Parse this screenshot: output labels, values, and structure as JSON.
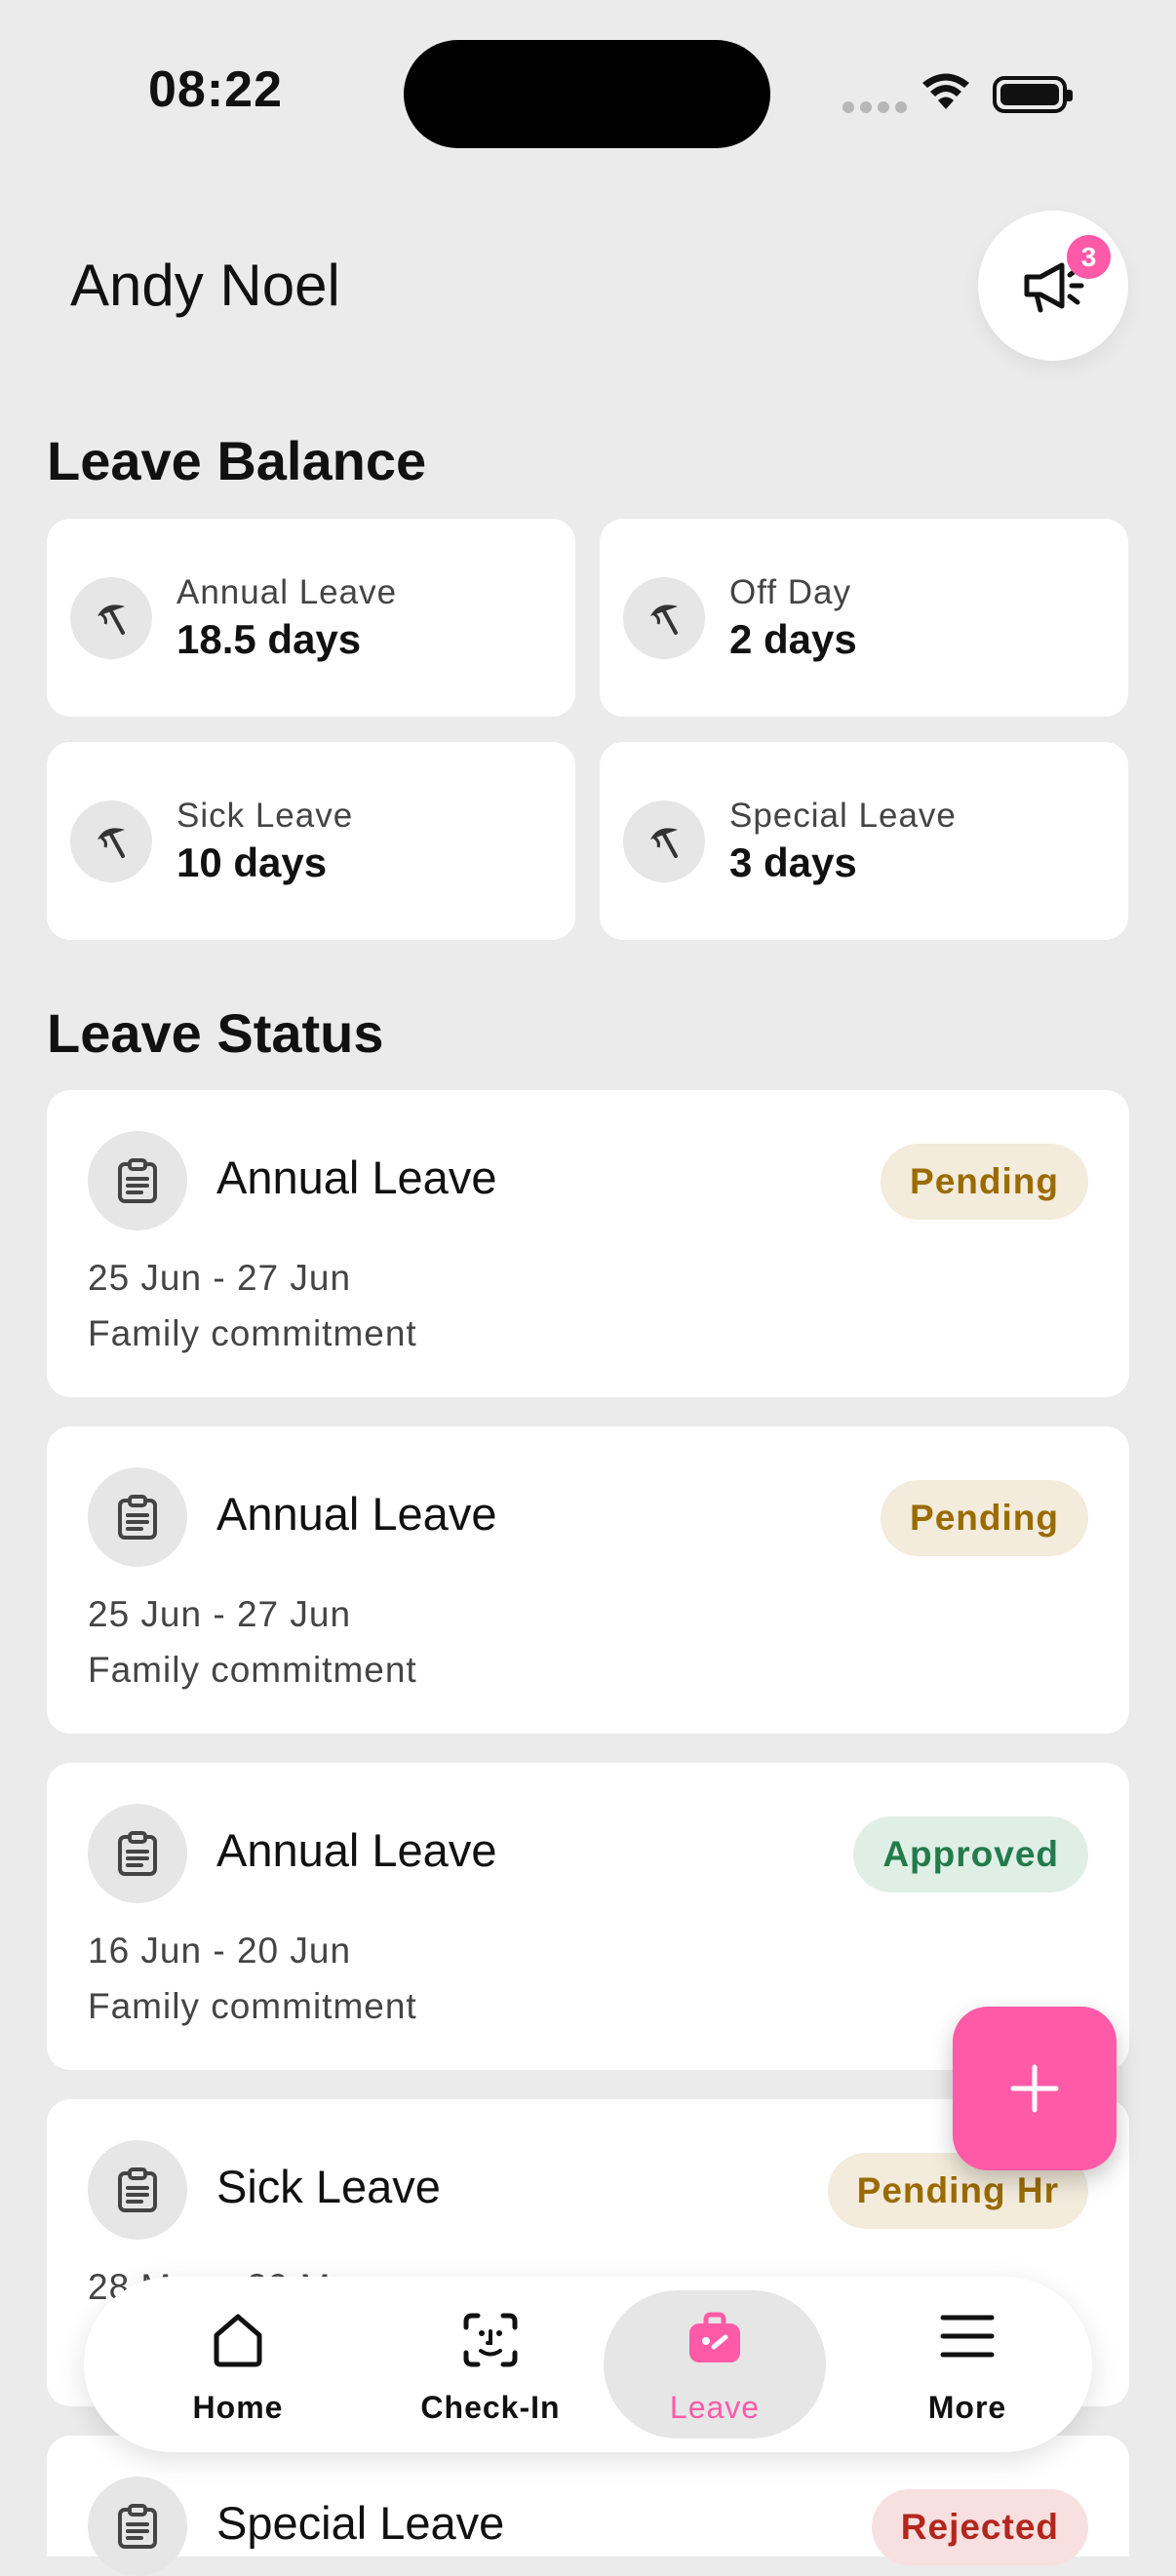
{
  "status_bar": {
    "time": "08:22"
  },
  "header": {
    "user_name": "Andy Noel",
    "notification_count": "3"
  },
  "leave_balance": {
    "title": "Leave Balance",
    "items": [
      {
        "label": "Annual Leave",
        "value": "18.5 days"
      },
      {
        "label": "Off Day",
        "value": "2 days"
      },
      {
        "label": "Sick Leave",
        "value": "10 days"
      },
      {
        "label": "Special Leave",
        "value": "3 days"
      }
    ]
  },
  "leave_status": {
    "title": "Leave Status",
    "items": [
      {
        "type": "Annual Leave",
        "status": "Pending",
        "dates": "25 Jun - 27 Jun",
        "reason": "Family commitment"
      },
      {
        "type": "Annual Leave",
        "status": "Pending",
        "dates": "25 Jun - 27 Jun",
        "reason": "Family commitment"
      },
      {
        "type": "Annual Leave",
        "status": "Approved",
        "dates": "16 Jun - 20 Jun",
        "reason": "Family commitment"
      },
      {
        "type": "Sick Leave",
        "status": "Pending Hr",
        "dates": "28 May - 30 May",
        "reason": ""
      },
      {
        "type": "Special Leave",
        "status": "Rejected",
        "dates": "",
        "reason": ""
      }
    ]
  },
  "bottom_nav": {
    "items": [
      {
        "label": "Home",
        "icon": "home-icon"
      },
      {
        "label": "Check-In",
        "icon": "face-scan-icon"
      },
      {
        "label": "Leave",
        "icon": "bag-icon",
        "active": true
      },
      {
        "label": "More",
        "icon": "menu-icon"
      }
    ]
  },
  "colors": {
    "accent": "#ff5aa8",
    "background": "#ebebeb",
    "pending": "#9a6b00",
    "approved": "#237a4b",
    "rejected": "#b3261e"
  }
}
